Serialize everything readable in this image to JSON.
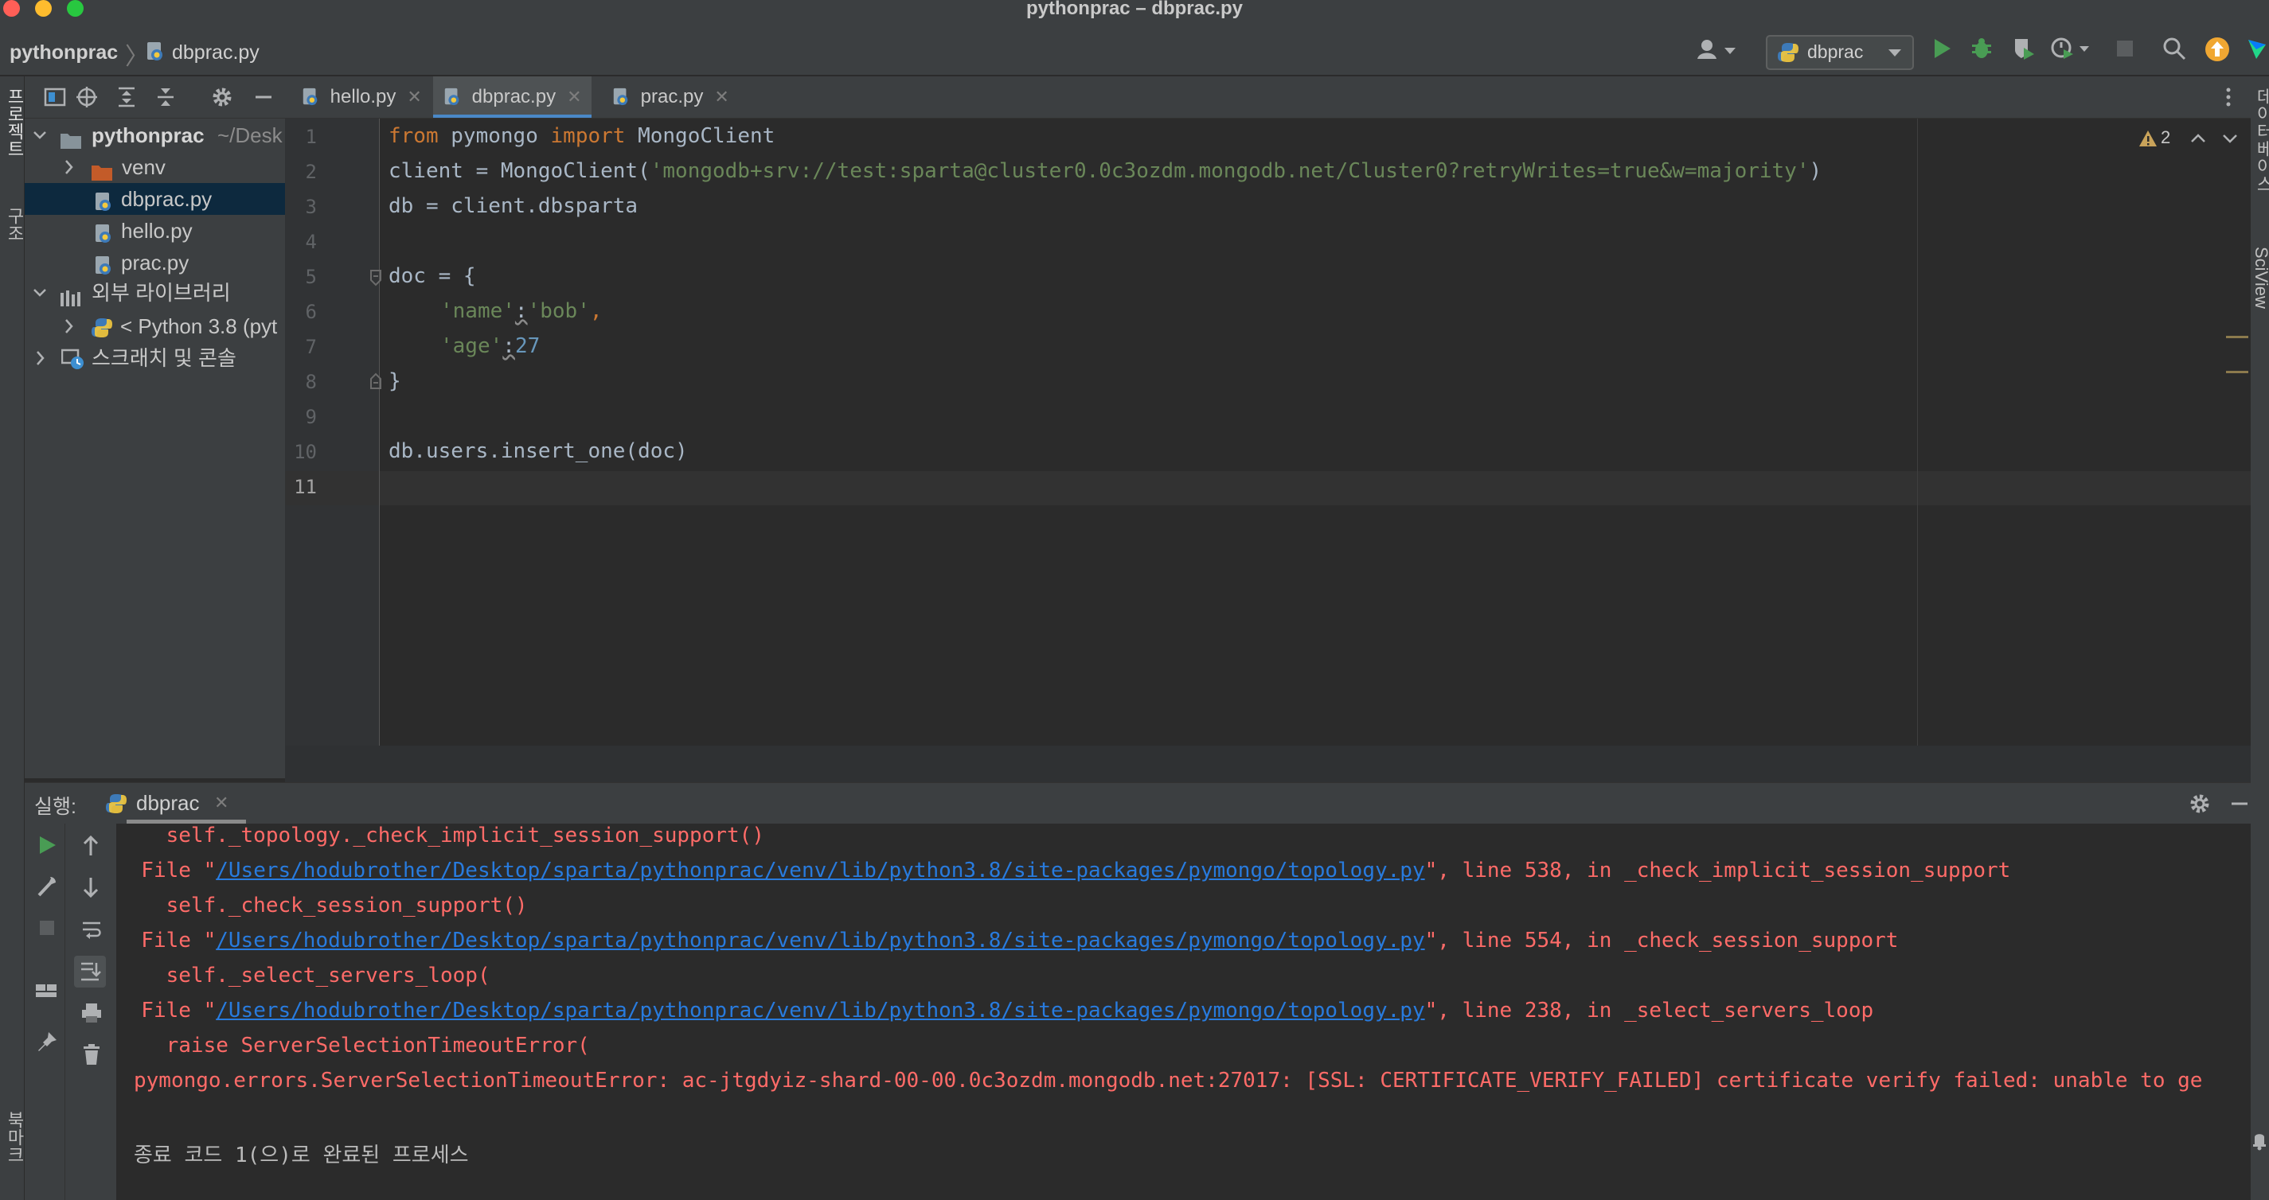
{
  "window": {
    "title": "pythonprac – dbprac.py"
  },
  "navbar": {
    "root": "pythonprac",
    "file": "dbprac.py"
  },
  "toolbar": {
    "run_config": "dbprac"
  },
  "left_strip": {
    "project_label": "프로젝트",
    "structure_label": "구조",
    "bookmarks_label": "북마크"
  },
  "right_strip": {
    "database_label": "데이터베이스",
    "sciview_label": "SciView"
  },
  "project_tree": {
    "root_name": "pythonprac",
    "root_path": "~/Desk",
    "items": [
      {
        "label": "venv"
      },
      {
        "label": "dbprac.py"
      },
      {
        "label": "hello.py"
      },
      {
        "label": "prac.py"
      },
      {
        "label": "외부 라이브러리"
      },
      {
        "label": "< Python 3.8 (pyt"
      },
      {
        "label": "스크래치 및 콘솔"
      }
    ]
  },
  "editor": {
    "tabs": [
      {
        "label": "hello.py"
      },
      {
        "label": "dbprac.py"
      },
      {
        "label": "prac.py"
      }
    ],
    "warning_count": "2",
    "line_numbers": [
      "1",
      "2",
      "3",
      "4",
      "5",
      "6",
      "7",
      "8",
      "9",
      "10",
      "11"
    ],
    "code": {
      "l1_kw1": "from",
      "l1_mod": " pymongo ",
      "l1_kw2": "import",
      "l1_name": " MongoClient",
      "l2_pre": "client = MongoClient(",
      "l2_str": "'mongodb+srv://test:sparta@cluster0.0c3ozdm.mongodb.net/Cluster0?retryWrites=true&w=majority'",
      "l2_post": ")",
      "l3": "db = client.dbsparta",
      "l5": "doc = {",
      "l6_key": "'name'",
      "l6_colon": ":",
      "l6_val": "'bob'",
      "l6_comma": ",",
      "l7_key": "'age'",
      "l7_colon": ":",
      "l7_val": "27",
      "l8": "}",
      "l10": "db.users.insert_one(doc)"
    }
  },
  "run_panel": {
    "label": "실행:",
    "tab": "dbprac",
    "output": {
      "o1": "    self._topology._check_implicit_session_support()",
      "o2_pre": "  File \"",
      "o2_link": "/Users/hodubrother/Desktop/sparta/pythonprac/venv/lib/python3.8/site-packages/pymongo/topology.py",
      "o2_post": "\", line 538, in _check_implicit_session_support",
      "o3": "    self._check_session_support()",
      "o4_pre": "  File \"",
      "o4_link": "/Users/hodubrother/Desktop/sparta/pythonprac/venv/lib/python3.8/site-packages/pymongo/topology.py",
      "o4_post": "\", line 554, in _check_session_support",
      "o5": "    self._select_servers_loop(",
      "o6_pre": "  File \"",
      "o6_link": "/Users/hodubrother/Desktop/sparta/pythonprac/venv/lib/python3.8/site-packages/pymongo/topology.py",
      "o6_post": "\", line 238, in _select_servers_loop",
      "o7": "    raise ServerSelectionTimeoutError(",
      "o8": "pymongo.errors.ServerSelectionTimeoutError: ac-jtgdyiz-shard-00-00.0c3ozdm.mongodb.net:27017: [SSL: CERTIFICATE_VERIFY_FAILED] certificate verify failed: unable to ge",
      "o10": "종료 코드 1(으)로 완료된 프로세스"
    }
  },
  "colors": {
    "keyword": "#cc7832",
    "string": "#6a8759",
    "number": "#6897bb",
    "error": "#ff6b68",
    "link": "#287bde",
    "selection": "#0d293e"
  }
}
